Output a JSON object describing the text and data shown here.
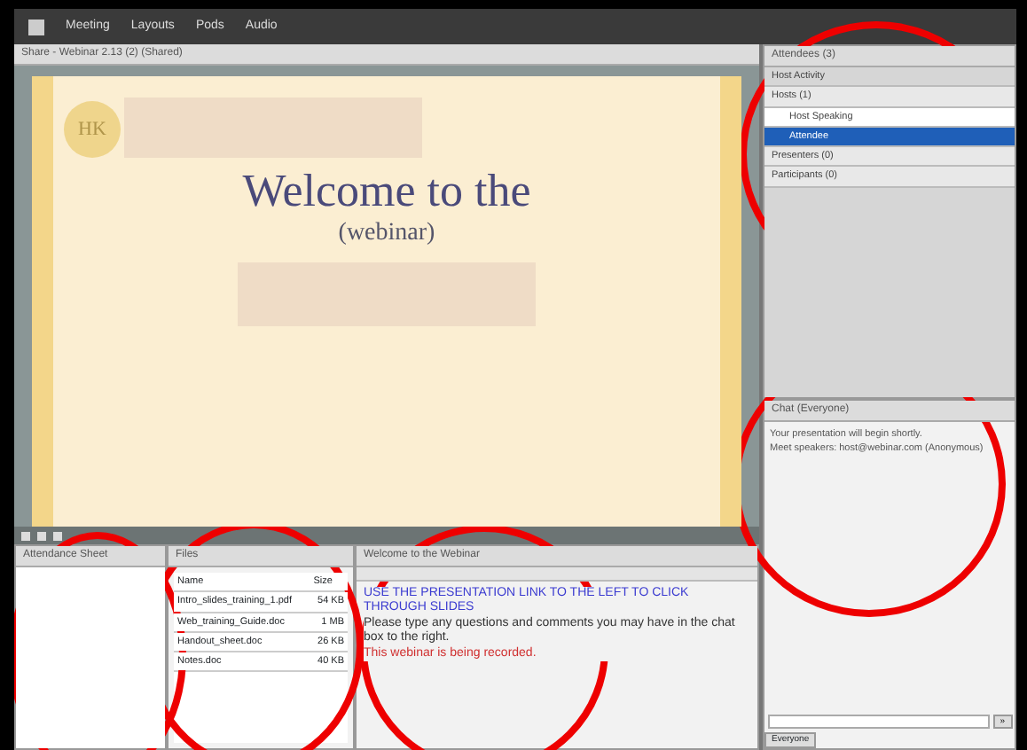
{
  "menu_bar": {
    "items": [
      "Meeting",
      "Layouts",
      "Pods",
      "Audio"
    ]
  },
  "share_pod": {
    "title": "Share - Webinar 2.13 (2) (Shared)",
    "slide": {
      "logo": "HK",
      "title": "Welcome to the",
      "subtitle": "(webinar)"
    }
  },
  "attendee_pod": {
    "title": "Attendees (3)",
    "circled": true,
    "rows": [
      {
        "label": "Host Activity",
        "kind": "header",
        "selected": false
      },
      {
        "label": "Hosts (1)",
        "kind": "group",
        "selected": false
      },
      {
        "label": "Host Speaking",
        "kind": "person",
        "selected": false
      },
      {
        "label": "Attendee",
        "kind": "person",
        "selected": true
      },
      {
        "label": "Presenters (0)",
        "kind": "group",
        "selected": false
      },
      {
        "label": "Participants (0)",
        "kind": "group",
        "selected": false
      }
    ]
  },
  "chat_pod": {
    "title": "Chat (Everyone)",
    "circled": true,
    "messages": [
      "Your presentation will begin shortly.",
      "Meet speakers: host@webinar.com (Anonymous)"
    ],
    "send": "»",
    "tab": "Everyone"
  },
  "notes_pod": {
    "title": "Attendance Sheet",
    "circled": true
  },
  "files_pod": {
    "title": "Files",
    "circled": true,
    "columns": [
      "Name",
      "Size"
    ],
    "rows": [
      [
        "Intro_slides_training_1.pdf",
        "54 KB"
      ],
      [
        "Web_training_Guide.doc",
        "1 MB"
      ],
      [
        "Handout_sheet.doc",
        "26 KB"
      ],
      [
        "Notes.doc",
        "40 KB"
      ]
    ]
  },
  "welcome_pod": {
    "title": "Welcome to the Webinar",
    "circled": true,
    "paragraphs": [
      {
        "text": "USE THE PRESENTATION LINK TO THE LEFT TO CLICK THROUGH SLIDES",
        "color": "#3a3ad0"
      },
      {
        "text": "Please type any questions and comments you may have in the chat box to the right.",
        "color": "#333333"
      },
      {
        "text": "This webinar is being recorded.",
        "color": "#d03030"
      }
    ]
  }
}
